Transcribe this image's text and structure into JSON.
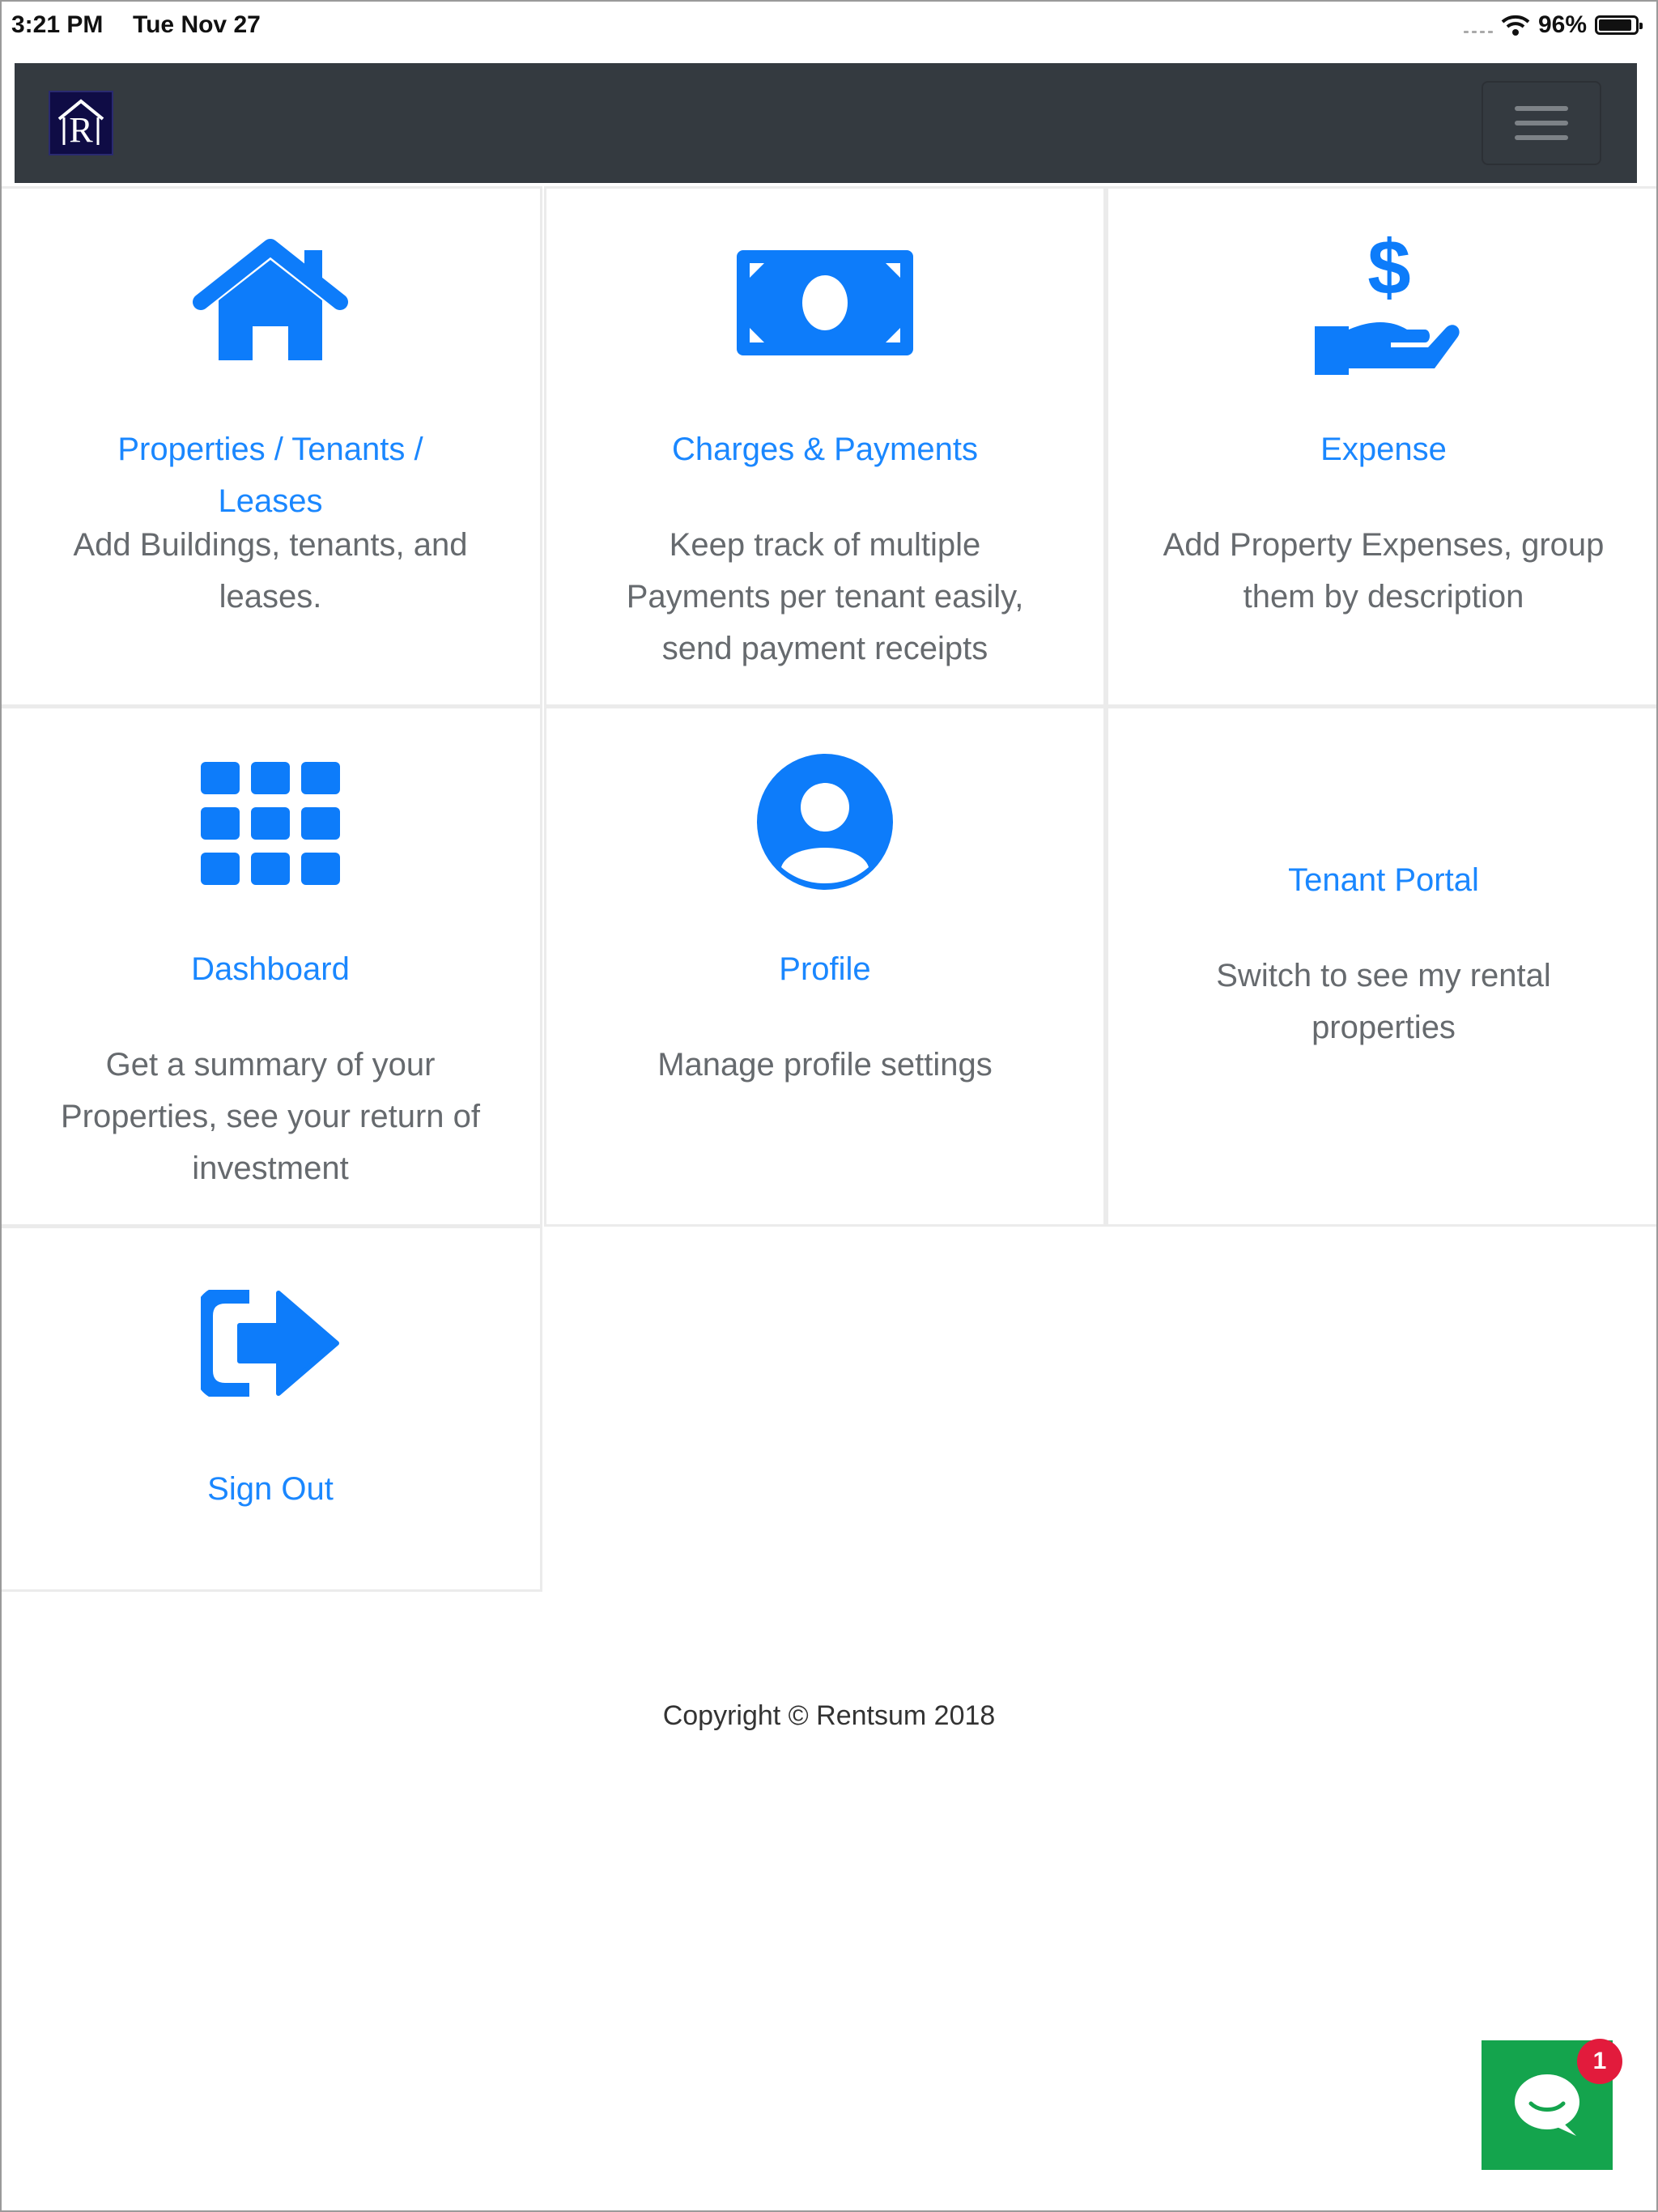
{
  "status_bar": {
    "time": "3:21 PM",
    "date": "Tue Nov 27",
    "battery": "96%",
    "icons": [
      "cellular-signal-icon",
      "wifi-icon",
      "battery-icon"
    ]
  },
  "navbar": {
    "brand_letter": "R",
    "menu_icon": "hamburger-menu-icon",
    "background": "#343a40"
  },
  "tiles": [
    {
      "icon": "home-icon",
      "title_line1": "Properties / Tenants /",
      "title_line2": "Leases",
      "desc_line1": "Add Buildings, tenants, and",
      "desc_line2": "leases."
    },
    {
      "icon": "money-bill-icon",
      "title": "Charges & Payments",
      "desc_line1": "Keep track of multiple",
      "desc_line2": "Payments per tenant easily,",
      "desc_line3": "send payment receipts"
    },
    {
      "icon": "hand-dollar-icon",
      "title": "Expense",
      "desc_line1": "Add Property Expenses, group",
      "desc_line2": "them by description"
    },
    {
      "icon": "grid-icon",
      "title": "Dashboard",
      "desc_line1": "Get a summary of your",
      "desc_line2": "Properties, see your return of",
      "desc_line3": "investment"
    },
    {
      "icon": "user-circle-icon",
      "title": "Profile",
      "desc_line1": "Manage profile settings"
    },
    {
      "title": "Tenant Portal",
      "desc_line1": "Switch to see my rental",
      "desc_line2": "properties"
    },
    {
      "icon": "sign-out-icon",
      "title": "Sign Out"
    }
  ],
  "footer": {
    "copyright": "Copyright © Rentsum 2018"
  },
  "chat": {
    "icon": "chat-bubble-icon",
    "badge_count": "1",
    "color": "#14a44d"
  },
  "colors": {
    "accent": "#1a87ff",
    "badge": "#e21b3c"
  }
}
